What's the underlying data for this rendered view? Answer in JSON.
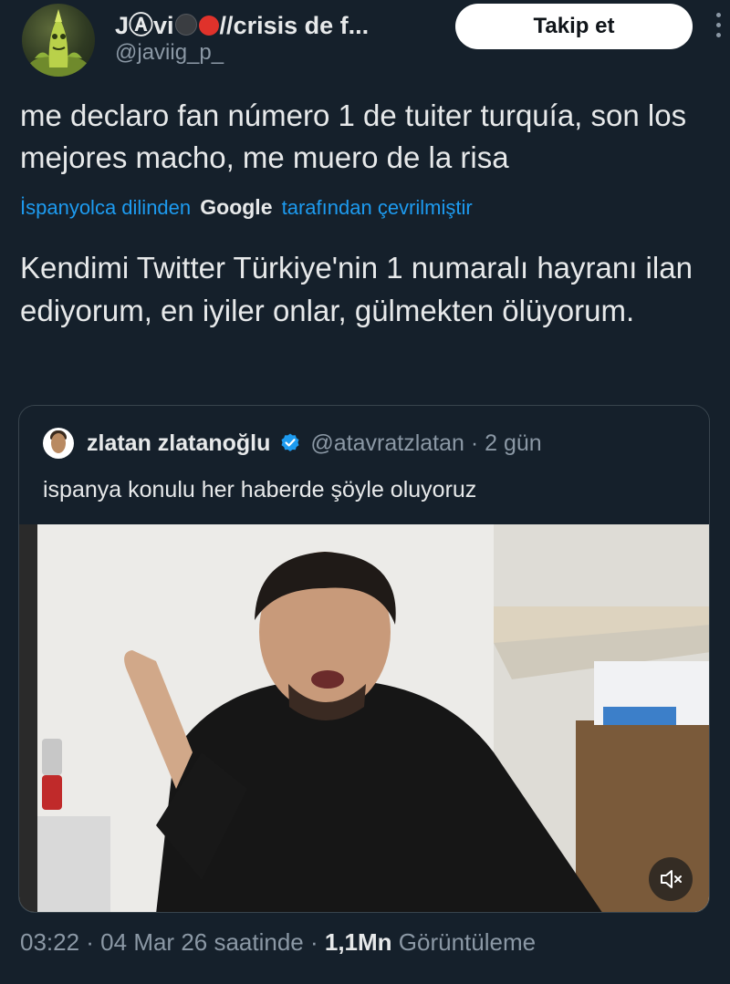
{
  "author": {
    "name_prefix": "JⒶvi",
    "name_suffix": "//crisis de f...",
    "handle": "@javiig_p_",
    "follow_label": "Takip et"
  },
  "tweet": {
    "text": "me declaro fan número 1 de tuiter turquía, son los mejores macho, me muero de la risa",
    "translation_prefix": "İspanyolca dilinden",
    "translation_provider": "Google",
    "translation_suffix": "tarafından çevrilmiştir",
    "translated_text": "Kendimi Twitter Türkiye'nin 1 numaralı hayranı ilan ediyorum, en iyiler onlar, gülmekten ölüyorum."
  },
  "quoted_tweet": {
    "name": "zlatan zlatanoğlu",
    "handle_time": "@atavratzlatan · 2 gün",
    "text": "ispanya konulu her haberde şöyle oluyoruz"
  },
  "meta": {
    "time_date": "03:22 · 04 Mar 26 saatinde ·",
    "views": "1,1Mn",
    "views_label": "Görüntüleme"
  },
  "colors": {
    "background": "#15202b",
    "accent": "#1d9bf0",
    "muted_text": "#8b98a5",
    "verified": "#1d9bf0"
  },
  "icons": [
    "more-icon",
    "verified-icon",
    "mute-icon"
  ]
}
